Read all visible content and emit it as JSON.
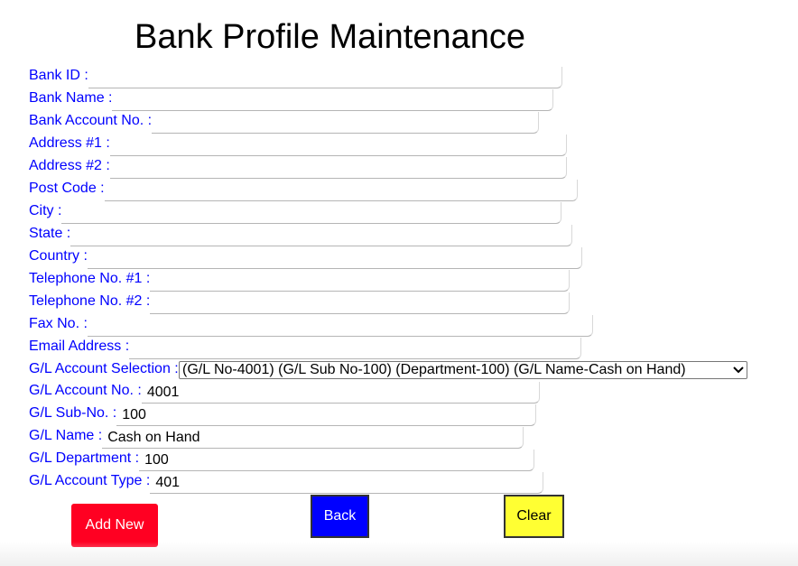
{
  "page": {
    "title": "Bank Profile Maintenance"
  },
  "fields": [
    {
      "label": "Bank ID :",
      "value": ""
    },
    {
      "label": "Bank Name :",
      "value": ""
    },
    {
      "label": "Bank Account No. :",
      "value": ""
    },
    {
      "label": "Address #1 :",
      "value": ""
    },
    {
      "label": "Address #2 :",
      "value": ""
    },
    {
      "label": "Post Code :",
      "value": ""
    },
    {
      "label": "City :",
      "value": ""
    },
    {
      "label": "State :",
      "value": ""
    },
    {
      "label": "Country :",
      "value": ""
    },
    {
      "label": "Telephone No. #1 :",
      "value": ""
    },
    {
      "label": "Telephone No. #2 :",
      "value": ""
    },
    {
      "label": "Fax No. :",
      "value": ""
    },
    {
      "label": "Email Address :",
      "value": ""
    }
  ],
  "gl_selection": {
    "label": "G/L Account Selection :",
    "selected": "(G/L No-4001) (G/L Sub No-100) (Department-100) (G/L Name-Cash on Hand)"
  },
  "gl_fields": [
    {
      "label": "G/L Account No. :",
      "value": "4001"
    },
    {
      "label": "G/L Sub-No. :",
      "value": "100"
    },
    {
      "label": "G/L Name :",
      "value": "Cash on Hand"
    },
    {
      "label": "G/L Department :",
      "value": "100"
    },
    {
      "label": "G/L Account Type :",
      "value": "401"
    }
  ],
  "buttons": {
    "add_new": "Add New",
    "back": "Back",
    "clear": "Clear"
  },
  "colors": {
    "label": "#0000ff",
    "add_new_bg": "#ff0022",
    "back_bg": "#0000ff",
    "clear_bg": "#ffff33"
  }
}
